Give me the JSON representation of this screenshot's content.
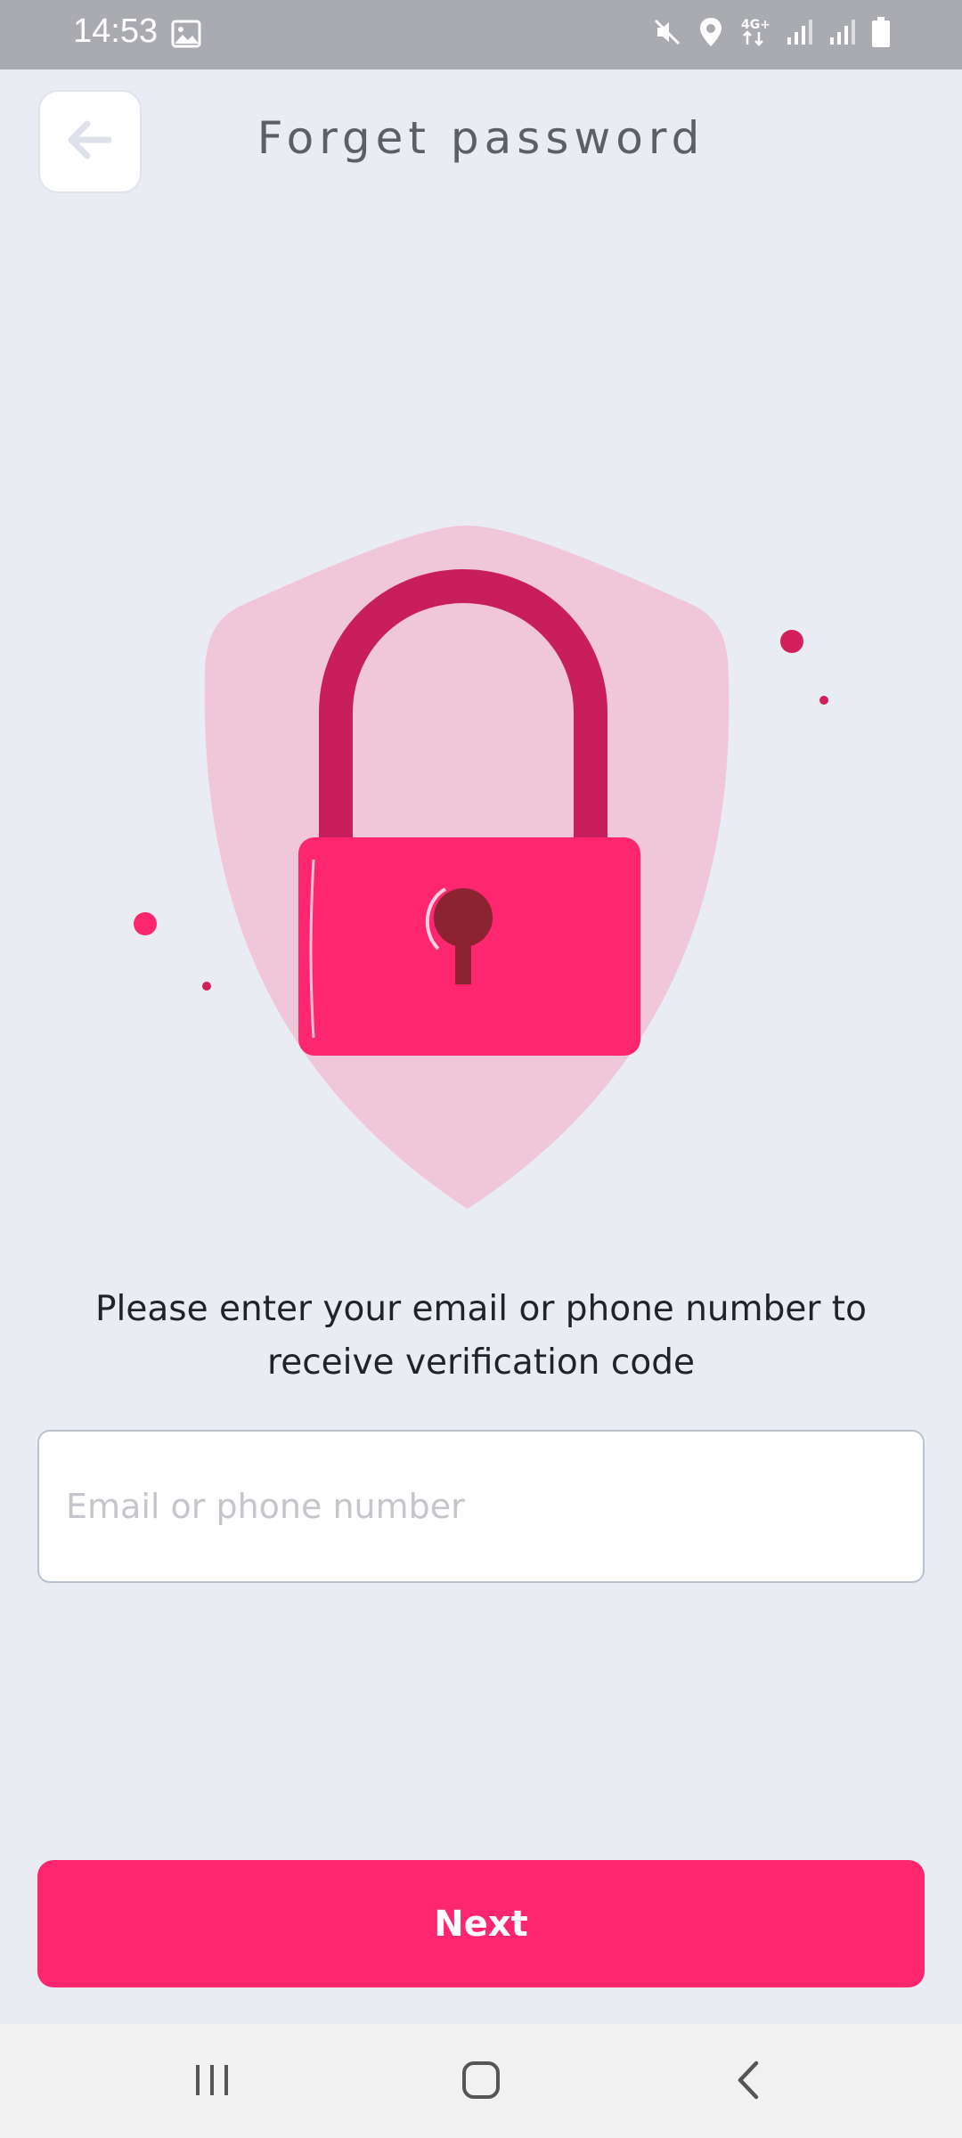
{
  "status_bar": {
    "time": "14:53",
    "left_icons": [
      "gallery-icon"
    ],
    "right_icons": [
      "mute-icon",
      "location-icon",
      "4g-data-icon",
      "signal-icon",
      "signal-icon",
      "battery-icon"
    ]
  },
  "header": {
    "back_icon": "arrow-left-icon",
    "title": "Forget password"
  },
  "illustration": {
    "icon": "shield-lock",
    "colors": {
      "shield": "#f0c6d9",
      "shackle": "#c81e5c",
      "body": "#ff2670",
      "keyhole": "#8b2330"
    }
  },
  "instruction": {
    "line1": "Please enter your email or phone number to",
    "line2": "receive verification code"
  },
  "form": {
    "contact_placeholder": "Email or phone number",
    "contact_value": ""
  },
  "actions": {
    "next_label": "Next"
  },
  "nav_bar": {
    "icons": [
      "recent-apps-icon",
      "home-icon",
      "back-icon"
    ]
  },
  "colors": {
    "accent": "#ff2670",
    "background": "#e9ecf3"
  }
}
